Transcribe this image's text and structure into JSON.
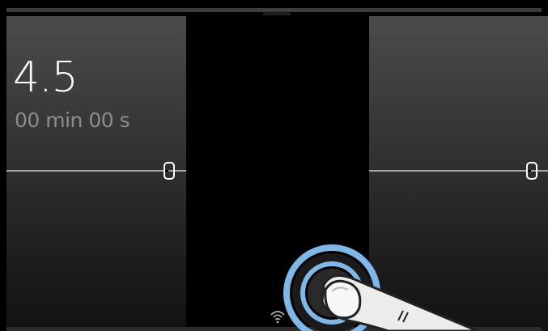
{
  "display": {
    "value": "4.5",
    "duration": "00 min 00 s"
  },
  "icons": {
    "wifi": "wifi-icon",
    "gesture": "touch-hand-icon"
  },
  "colors": {
    "accent_ring": "#7fb7e6",
    "text_primary": "#ffffff",
    "text_secondary": "#8c8c8c",
    "background": "#000000"
  }
}
